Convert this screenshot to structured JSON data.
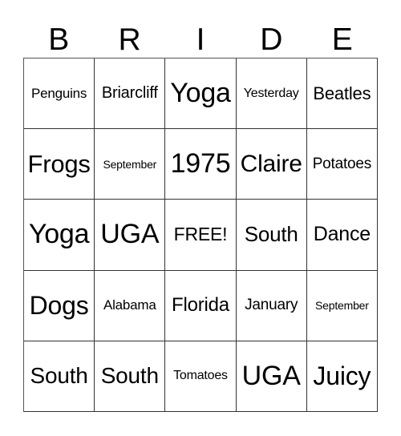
{
  "header": [
    "B",
    "R",
    "I",
    "D",
    "E"
  ],
  "cells": [
    [
      "Penguins",
      "Briarcliff",
      "Yoga",
      "Yesterday",
      "Beatles"
    ],
    [
      "Frogs",
      "September",
      "1975",
      "Claire",
      "Potatoes"
    ],
    [
      "Yoga",
      "UGA",
      "FREE!",
      "South",
      "Dance"
    ],
    [
      "Dogs",
      "Alabama",
      "Florida",
      "January",
      "September"
    ],
    [
      "South",
      "South",
      "Tomatoes",
      "UGA",
      "Juicy"
    ]
  ]
}
